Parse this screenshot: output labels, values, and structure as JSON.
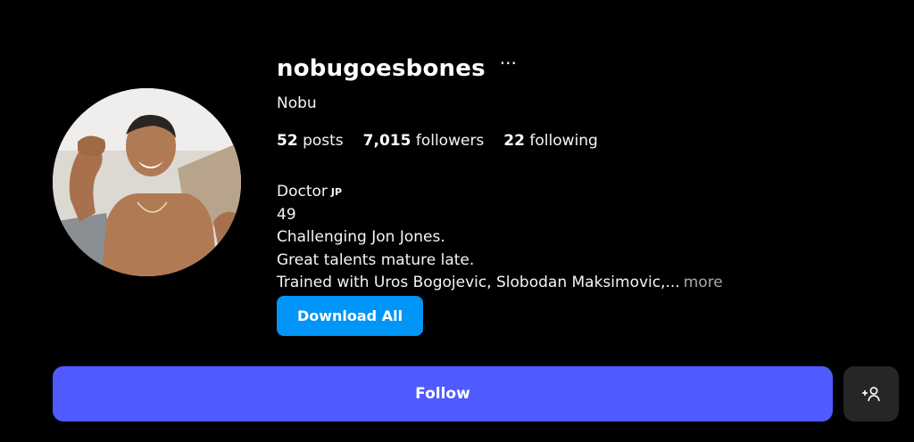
{
  "profile": {
    "username": "nobugoesbones",
    "options_icon": "more-horizontal-icon",
    "full_name": "Nobu",
    "avatar_icon": "profile-photo"
  },
  "stats": {
    "posts_count": "52",
    "posts_label": "posts",
    "followers_count": "7,015",
    "followers_label": "followers",
    "following_count": "22",
    "following_label": "following"
  },
  "bio": {
    "line1": "Doctor",
    "flag": "JP",
    "line2": "49",
    "line3": "Challenging Jon Jones.",
    "line4": "Great talents mature late.",
    "line5": "Trained with Uros Bogojevic, Slobodan Maksimovic,...",
    "more_label": "more"
  },
  "actions": {
    "download_label": "Download All",
    "follow_label": "Follow",
    "suggest_icon": "add-person-icon"
  },
  "colors": {
    "background": "#000000",
    "download_button": "#0095f6",
    "follow_button": "#4f5bff",
    "suggest_button": "#262626",
    "muted_text": "#a8a8a8"
  }
}
